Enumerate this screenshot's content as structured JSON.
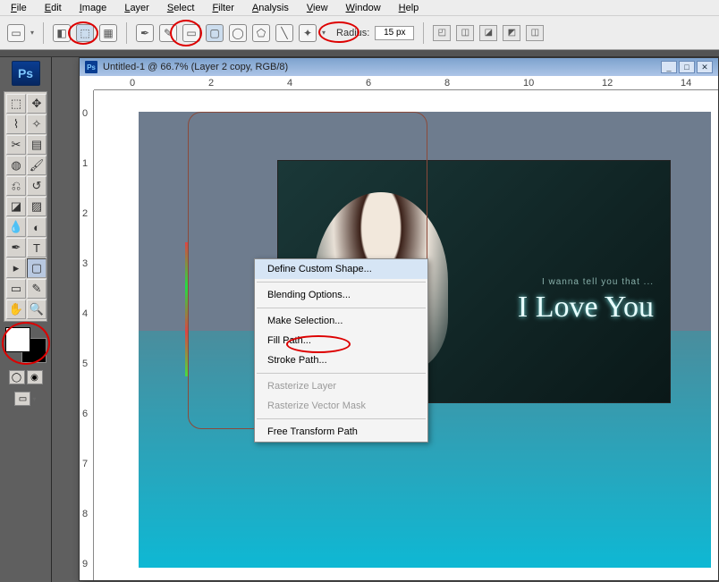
{
  "menus": [
    "File",
    "Edit",
    "Image",
    "Layer",
    "Select",
    "Filter",
    "Analysis",
    "View",
    "Window",
    "Help"
  ],
  "options": {
    "radius_label": "Radius:",
    "radius_value": "15 px"
  },
  "doc_title": "Untitled-1 @ 66.7% (Layer 2 copy, RGB/8)",
  "ruler_h": [
    "0",
    "2",
    "4",
    "6",
    "8",
    "10",
    "12",
    "14"
  ],
  "ruler_v": [
    "0",
    "1",
    "2",
    "3",
    "4",
    "5",
    "6",
    "7",
    "8",
    "9"
  ],
  "photo_text": {
    "small": "I wanna tell you that ...",
    "script": "I Love You"
  },
  "context_menu": [
    {
      "label": "Define Custom Shape...",
      "hl": true
    },
    {
      "sep": true
    },
    {
      "label": "Blending Options..."
    },
    {
      "sep": true
    },
    {
      "label": "Make Selection..."
    },
    {
      "label": "Fill Path...",
      "circled": true
    },
    {
      "label": "Stroke Path..."
    },
    {
      "sep": true
    },
    {
      "label": "Rasterize Layer",
      "disabled": true
    },
    {
      "label": "Rasterize Vector Mask",
      "disabled": true
    },
    {
      "sep": true
    },
    {
      "label": "Free Transform Path"
    }
  ]
}
